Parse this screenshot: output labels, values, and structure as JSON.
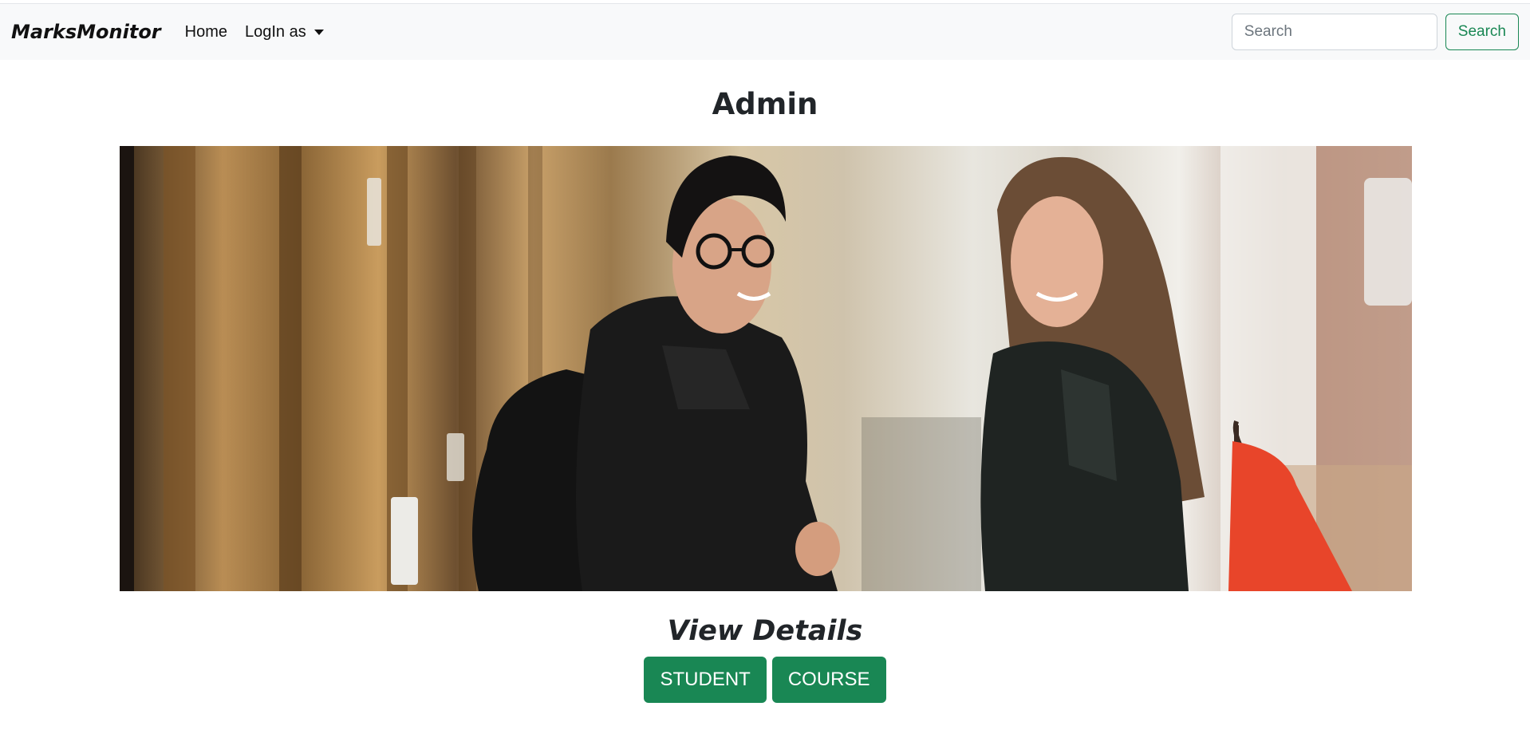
{
  "navbar": {
    "brand": "MarksMonitor",
    "home_label": "Home",
    "login_label": "LogIn as",
    "search_placeholder": "Search",
    "search_button": "Search"
  },
  "main": {
    "title": "Admin",
    "section_title": "View Details",
    "buttons": {
      "student": "STUDENT",
      "course": "COURSE"
    }
  },
  "colors": {
    "accent": "#198754",
    "navbar_bg": "#f8f9fa"
  }
}
